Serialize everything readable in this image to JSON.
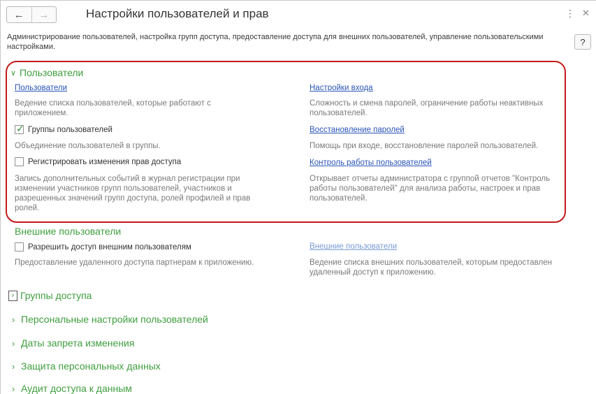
{
  "header": {
    "back_icon": "arrow-left",
    "forward_icon": "arrow-right",
    "title": "Настройки пользователей и прав",
    "more_icon": "vertical-dots",
    "close_icon": "close",
    "help_label": "?"
  },
  "description": "Администрирование пользователей, настройка групп доступа, предоставление доступа для внешних пользователей, управление пользовательскими настройками.",
  "users_section": {
    "title": "Пользователи",
    "users_link": "Пользователи",
    "users_note": "Ведение списка пользователей, которые работают с приложением.",
    "groups_checkbox": "Группы пользователей",
    "groups_checked": true,
    "groups_note": "Объединение пользователей в группы.",
    "log_checkbox": "Регистрировать изменения прав доступа",
    "log_checked": false,
    "log_note": "Запись дополнительных событий в журнал регистрации при изменении участников групп пользователей, участников и разрешенных значений групп доступа, ролей профилей и прав ролей.",
    "login_link": "Настройки входа",
    "login_note": "Сложность и смена паролей, ограничение работы неактивных пользователей.",
    "recovery_link": "Восстановление паролей",
    "recovery_note": "Помощь при входе, восстановление паролей пользователей.",
    "monitor_link": "Контроль работы пользователей",
    "monitor_note": "Открывает отчеты администратора с группой отчетов \"Контроль работы пользователей\" для анализа работы, настроек и прав пользователей."
  },
  "external_section": {
    "title": "Внешние пользователи",
    "allow_checkbox": "Разрешить доступ внешним пользователям",
    "allow_checked": false,
    "allow_note": "Предоставление удаленного доступа партнерам к приложению.",
    "external_link": "Внешние пользователи",
    "external_note": "Ведение списка внешних пользователей, которым предоставлен удаленный доступ к приложению."
  },
  "collapsed_sections": [
    "Группы доступа",
    "Персональные настройки пользователей",
    "Даты запрета изменения",
    "Защита персональных данных",
    "Аудит доступа к данным"
  ],
  "colors": {
    "section_green": "#3f9e3f",
    "link_blue": "#2a55b8",
    "highlight_red": "#c41a1a"
  }
}
